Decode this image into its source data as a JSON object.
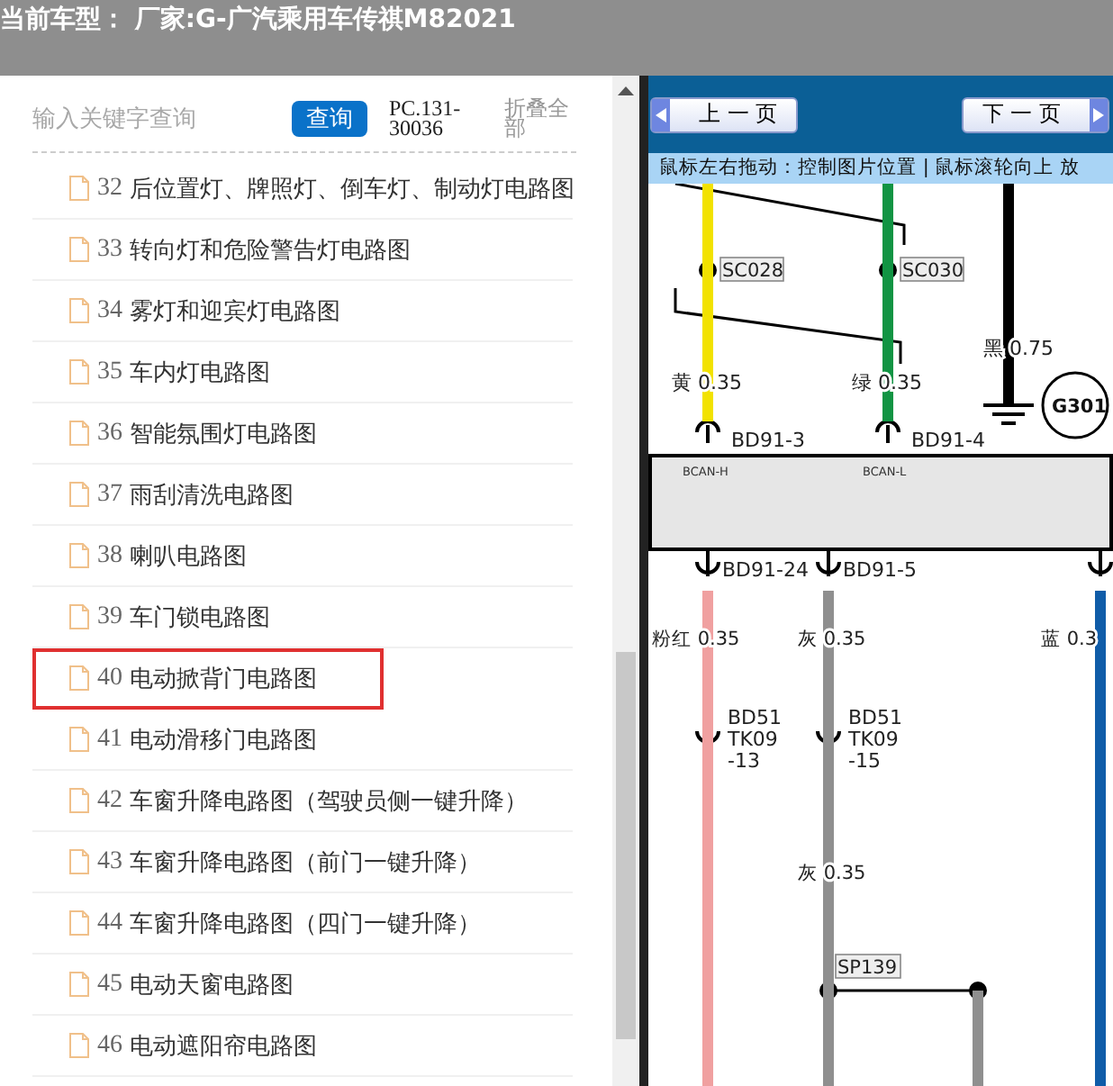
{
  "header": {
    "title": "当前车型： 厂家:G-广汽乘用车传祺M82021"
  },
  "search": {
    "placeholder": "输入关键字查询",
    "button": "查询",
    "code": "PC.131-30036",
    "collapse": "折叠全部"
  },
  "items": [
    {
      "number": "32",
      "title": "后位置灯、牌照灯、倒车灯、制动灯电路图",
      "selected": false
    },
    {
      "number": "33",
      "title": "转向灯和危险警告灯电路图",
      "selected": false
    },
    {
      "number": "34",
      "title": "雾灯和迎宾灯电路图",
      "selected": false
    },
    {
      "number": "35",
      "title": "车内灯电路图",
      "selected": false
    },
    {
      "number": "36",
      "title": "智能氛围灯电路图",
      "selected": false
    },
    {
      "number": "37",
      "title": "雨刮清洗电路图",
      "selected": false
    },
    {
      "number": "38",
      "title": "喇叭电路图",
      "selected": false
    },
    {
      "number": "39",
      "title": "车门锁电路图",
      "selected": false
    },
    {
      "number": "40",
      "title": "电动掀背门电路图",
      "selected": true
    },
    {
      "number": "41",
      "title": "电动滑移门电路图",
      "selected": false
    },
    {
      "number": "42",
      "title": "车窗升降电路图（驾驶员侧一键升降）",
      "selected": false
    },
    {
      "number": "43",
      "title": "车窗升降电路图（前门一键升降）",
      "selected": false
    },
    {
      "number": "44",
      "title": "车窗升降电路图（四门一键升降）",
      "selected": false
    },
    {
      "number": "45",
      "title": "电动天窗电路图",
      "selected": false
    },
    {
      "number": "46",
      "title": "电动遮阳帘电路图",
      "selected": false
    }
  ],
  "viewer": {
    "prev": "上 一 页",
    "next": "下 一 页",
    "hint": "鼠标左右拖动：控制图片位置 | 鼠标滚轮向上 放"
  },
  "diagram": {
    "top_wires": [
      {
        "splice": "SC028",
        "label": "黄 0.35",
        "connector": "BD91-3",
        "signal": "BCAN-H",
        "color": "#f2e200"
      },
      {
        "splice": "SC030",
        "label": "绿 0.35",
        "connector": "BD91-4",
        "signal": "BCAN-L",
        "color": "#119443"
      }
    ],
    "ground_wire": {
      "label": "黑 0.75",
      "ground": "G301"
    },
    "bottom_wires": [
      {
        "connector": "BD91-24",
        "label": "粉红 0.35",
        "inline_connector": [
          "BD51",
          "TK09",
          "-13"
        ],
        "color": "#f0a0a0"
      },
      {
        "connector": "BD91-5",
        "label": "灰 0.35",
        "inline_connector": [
          "BD51",
          "TK09",
          "-15"
        ],
        "color": "#8f8f8f"
      },
      {
        "label": "蓝 0.3",
        "color": "#0f5ca8"
      }
    ],
    "lower_label": "灰 0.35",
    "splice": "SP139"
  }
}
